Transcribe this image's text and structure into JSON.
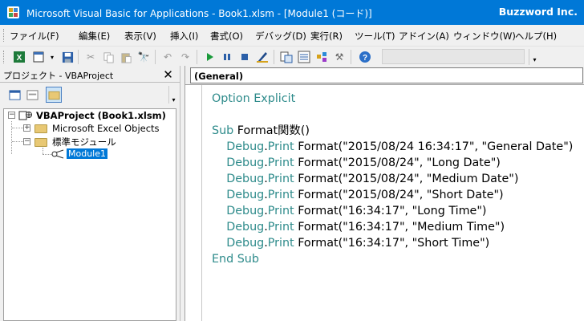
{
  "window": {
    "title": "Microsoft Visual Basic for Applications - Book1.xlsm - [Module1 (コード)]",
    "brand": "Buzzword Inc."
  },
  "menubar": {
    "items": [
      "ファイル(F)",
      "編集(E)",
      "表示(V)",
      "挿入(I)",
      "書式(O)",
      "デバッグ(D)",
      "実行(R)",
      "ツール(T)",
      "アドイン(A)",
      "ウィンドウ(W)",
      "ヘルプ(H)"
    ]
  },
  "toolbar": {
    "icons": [
      "excel-icon",
      "insert-module-icon",
      "save-icon",
      "cut-icon",
      "copy-icon",
      "paste-icon",
      "find-icon",
      "undo-icon",
      "redo-icon",
      "run-icon",
      "break-icon",
      "reset-icon",
      "design-mode-icon",
      "project-explorer-icon",
      "properties-icon",
      "object-browser-icon",
      "toolbox-icon",
      "help-icon"
    ]
  },
  "project_panel": {
    "title": "プロジェクト - VBAProject",
    "tree": [
      {
        "label": "VBAProject (Book1.xlsm)",
        "level": 0
      },
      {
        "label": "Microsoft Excel Objects",
        "level": 1
      },
      {
        "label": "標準モジュール",
        "level": 1
      },
      {
        "label": "Module1",
        "level": 2,
        "selected": true
      }
    ]
  },
  "code_window": {
    "object_combo": "(General)",
    "lines": [
      {
        "kw": "Option Explicit",
        "rest": ""
      },
      {
        "kw": "",
        "rest": ""
      },
      {
        "kw": "Sub",
        "rest": " Format関数()"
      },
      {
        "indent": "    ",
        "kw": "Debug",
        "dot": ".",
        "kw2": "Print",
        "rest": " Format(\"2015/08/24 16:34:17\", \"General Date\")"
      },
      {
        "indent": "    ",
        "kw": "Debug",
        "dot": ".",
        "kw2": "Print",
        "rest": " Format(\"2015/08/24\", \"Long Date\")"
      },
      {
        "indent": "    ",
        "kw": "Debug",
        "dot": ".",
        "kw2": "Print",
        "rest": " Format(\"2015/08/24\", \"Medium Date\")"
      },
      {
        "indent": "    ",
        "kw": "Debug",
        "dot": ".",
        "kw2": "Print",
        "rest": " Format(\"2015/08/24\", \"Short Date\")"
      },
      {
        "indent": "    ",
        "kw": "Debug",
        "dot": ".",
        "kw2": "Print",
        "rest": " Format(\"16:34:17\", \"Long Time\")"
      },
      {
        "indent": "    ",
        "kw": "Debug",
        "dot": ".",
        "kw2": "Print",
        "rest": " Format(\"16:34:17\", \"Medium Time\")"
      },
      {
        "indent": "    ",
        "kw": "Debug",
        "dot": ".",
        "kw2": "Print",
        "rest": " Format(\"16:34:17\", \"Short Time\")"
      },
      {
        "kw": "End Sub",
        "rest": ""
      }
    ]
  },
  "colors": {
    "titlebar": "#0078d7",
    "keyword": "#2e8b8b",
    "selection": "#0078d7"
  }
}
